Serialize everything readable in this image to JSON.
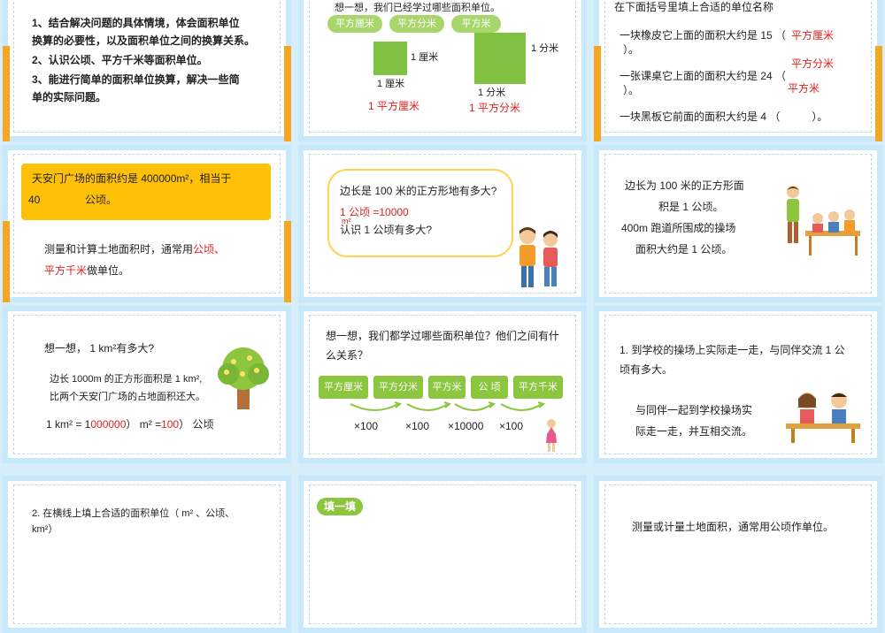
{
  "s1": {
    "l1": "1、结合解决问题的具体情境，体会面积单位",
    "l2": "换算的必要性，以及面积单位之间的换算关系。",
    "l3": "2、认识公顷、平方千米等面积单位。",
    "l4": "3、能进行简单的面积单位换算，解决一些简",
    "l5": "单的实际问题。"
  },
  "s2": {
    "top": "想一想，我们已经学过哪些面积单位。",
    "pills": [
      "平方厘米",
      "平方分米",
      "平方米"
    ],
    "cm_side": "1 厘米",
    "cm_bottom": "1 厘米",
    "cm_label": "1 平方厘米",
    "dm_side": "1 分米",
    "dm_bottom": "1 分米",
    "dm_label": "1 平方分米"
  },
  "s3": {
    "title": "在下面括号里填上合适的单位名称",
    "q1a": "一块橡皮它上面的面积大约是 15 （",
    "q1b": "）。",
    "a1": "平方厘米",
    "q2a": "一张课桌它上面的面积大约是 24 （",
    "q2b": "）。",
    "a2a": "平方分米",
    "a2b": "平方米",
    "q3": "一块黑板它前面的面积大约是 4 （　　　）。"
  },
  "s4": {
    "c1": "天安门广场的面积约是 400000m²，相当于",
    "c2a": "40",
    "c2b": "公顷。",
    "p1a": "测量和计算土地面积时，通常用",
    "p1b": "公顷、",
    "p2a": "平方千米",
    "p2b": "做单位。"
  },
  "s5": {
    "q": "边长是 100 米的正方形地有多大?",
    "a": "1 公顷 =10000",
    "a_sup": "m²",
    "q2": "认识 1 公顷有多大?"
  },
  "s6": {
    "l1": "边长为 100 米的正方形面",
    "l2": "积是 1 公顷。",
    "l3": "400m  跑道所围成的操场",
    "l4": "面积大约是 1 公顷。"
  },
  "s7": {
    "q": "想一想，  1 km²有多大?",
    "d1": "边长 1000m 的正方形面积是 1 km²,",
    "d2": "比两个天安门广场的占地面积还大。",
    "e1": "1 km² = 1",
    "e2": "000000",
    "e3": "） m² =",
    "e4": "100",
    "e5": "）  公顷"
  },
  "s8": {
    "q1": "想一想，我们都学过哪些面积单位？他们之间有什",
    "q2": "么关系？",
    "units": [
      "平方厘米",
      "平方分米",
      "平方米",
      "公  顷",
      "平方千米"
    ],
    "rates": [
      "×100",
      "×100",
      "×10000",
      "×100"
    ]
  },
  "s9": {
    "l1": "1. 到学校的操场上实际走一走，与同伴交流 1 公",
    "l2": "顷有多大。",
    "l3": "与同伴一起到学校操场实",
    "l4": "际走一走，并互相交流。"
  },
  "s10": {
    "l1": "2. 在横线上填上合适的面积单位（ m² 、公顷、",
    "l2": "km²）"
  },
  "s11": {
    "tag": "填一填"
  },
  "s12": {
    "l1": "测量或计量土地面积，通常用公顷作单位。"
  },
  "colors": {
    "orange": "#f5a623",
    "green": "#8cc63f",
    "red": "#e02020",
    "bg": "#d6eefa"
  }
}
